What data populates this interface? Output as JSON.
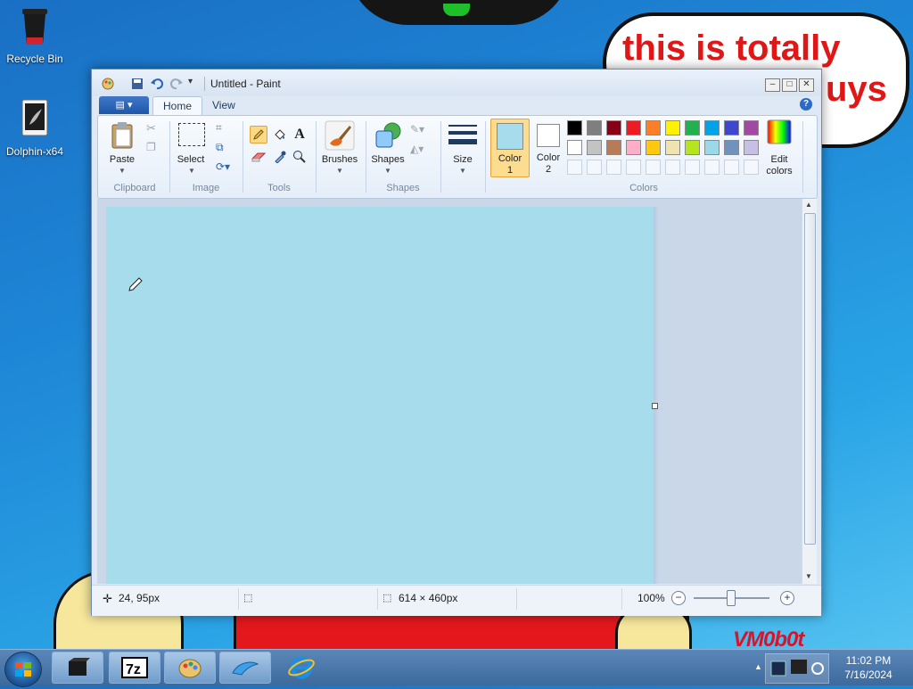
{
  "desktop": {
    "icons": [
      {
        "label": "Recycle Bin",
        "icon": "recycle-bin-icon"
      },
      {
        "label": "Dolphin-x64",
        "icon": "dolphin-app-icon"
      }
    ],
    "bubble_line1": "this is totally",
    "bubble_line2": "uys",
    "watermark": "VM0b0t"
  },
  "window": {
    "title": "Untitled - Paint",
    "tabs": [
      {
        "label": "Home",
        "active": true
      },
      {
        "label": "View",
        "active": false
      }
    ],
    "ribbon": {
      "clipboard": {
        "paste": "Paste",
        "group": "Clipboard"
      },
      "image": {
        "select": "Select",
        "group": "Image"
      },
      "tools": {
        "group": "Tools",
        "text_tool": "A"
      },
      "brushes": {
        "label": "Brushes"
      },
      "shapes": {
        "label": "Shapes",
        "group": "Shapes"
      },
      "size": {
        "label": "Size"
      },
      "colors": {
        "color1_label": "Color",
        "color1_num": "1",
        "color2_label": "Color",
        "color2_num": "2",
        "edit_label": "Edit",
        "edit_label2": "colors",
        "group": "Colors",
        "color1_value": "#a6dcec",
        "color2_value": "#ffffff",
        "palette_row1": [
          "#000000",
          "#7f7f7f",
          "#880015",
          "#ed1c24",
          "#ff7f27",
          "#fff200",
          "#22b14c",
          "#00a2e8",
          "#3f48cc",
          "#a349a4"
        ],
        "palette_row2": [
          "#ffffff",
          "#c3c3c3",
          "#b97a57",
          "#ffaec9",
          "#ffc90e",
          "#efe4b0",
          "#b5e61d",
          "#99d9ea",
          "#7092be",
          "#c8bfe7"
        ]
      }
    },
    "canvas_color": "#a6dcec",
    "status": {
      "cursor_pos": "24, 95px",
      "canvas_size": "614 × 460px",
      "zoom": "100%"
    }
  },
  "taskbar": {
    "time": "11:02 PM",
    "date": "7/16/2024"
  }
}
